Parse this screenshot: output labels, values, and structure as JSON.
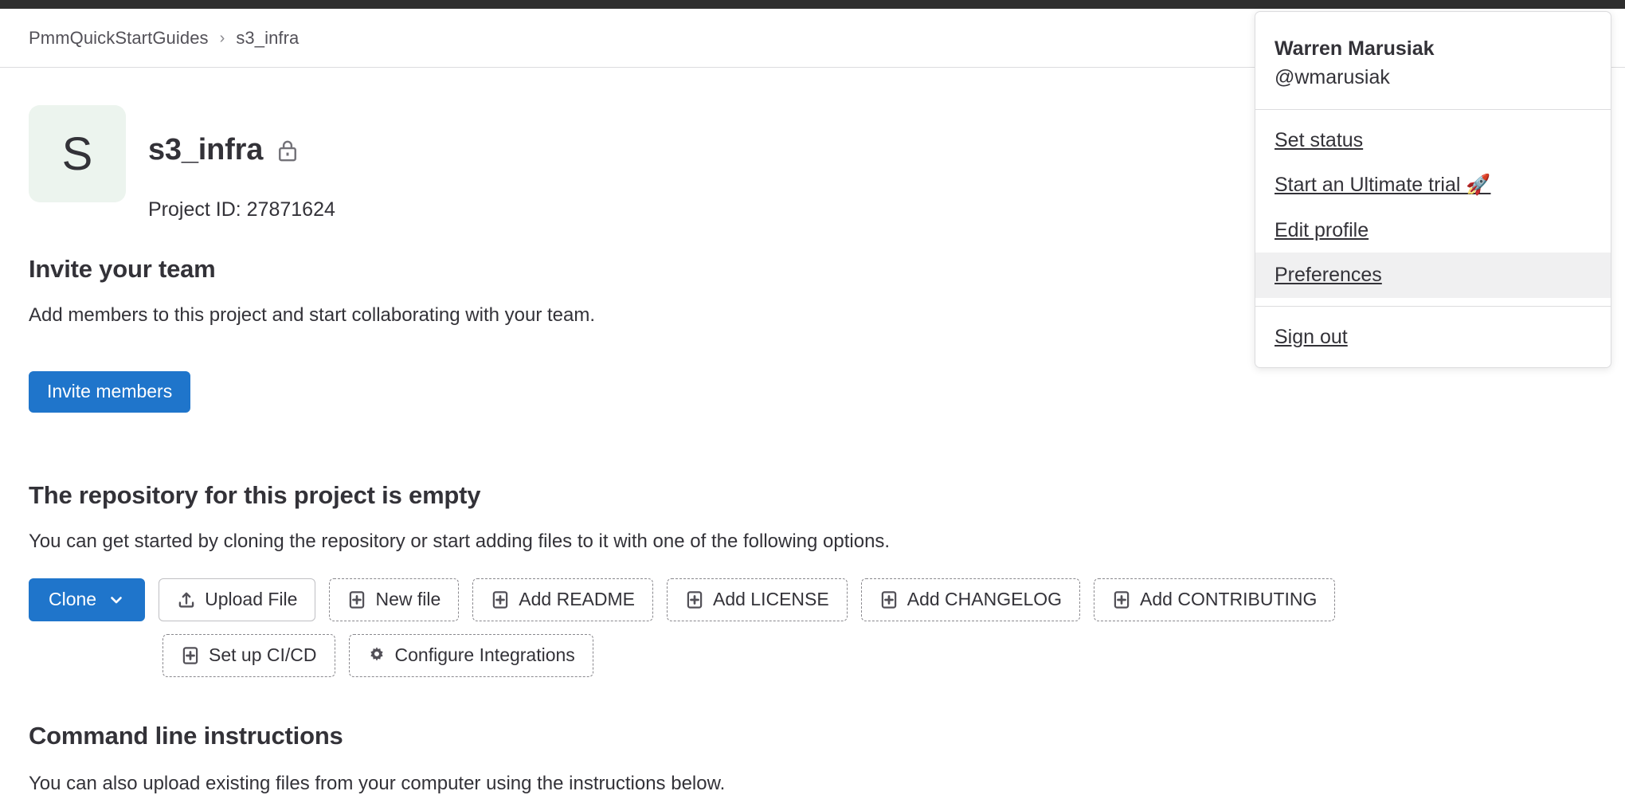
{
  "breadcrumb": {
    "items": [
      {
        "label": "PmmQuickStartGuides"
      },
      {
        "label": "s3_infra"
      }
    ],
    "separator": "›"
  },
  "project": {
    "avatar_letter": "S",
    "avatar_bg": "#ecf4ee",
    "name": "s3_infra",
    "visibility_icon": "lock-icon",
    "project_id_label": "Project ID: 27871624"
  },
  "header_actions": {
    "notifications_icon": "bell-icon"
  },
  "invite": {
    "heading": "Invite your team",
    "description": "Add members to this project and start collaborating with your team.",
    "button_label": "Invite members",
    "button_color": "#1f75cb"
  },
  "empty_repo": {
    "heading": "The repository for this project is empty",
    "description": "You can get started by cloning the repository or start adding files to it with one of the following options.",
    "rows": [
      [
        {
          "label": "Clone",
          "style": "clone",
          "icon": "chevron-down-icon",
          "icon_side": "right",
          "name": "clone-button"
        },
        {
          "label": "Upload File",
          "style": "solid",
          "icon": "upload-icon",
          "icon_side": "left",
          "name": "upload-file-button"
        },
        {
          "label": "New file",
          "style": "dashed",
          "icon": "plus-square-icon",
          "icon_side": "left",
          "name": "new-file-button"
        },
        {
          "label": "Add README",
          "style": "dashed",
          "icon": "plus-square-icon",
          "icon_side": "left",
          "name": "add-readme-button"
        },
        {
          "label": "Add LICENSE",
          "style": "dashed",
          "icon": "plus-square-icon",
          "icon_side": "left",
          "name": "add-license-button"
        },
        {
          "label": "Add CHANGELOG",
          "style": "dashed",
          "icon": "plus-square-icon",
          "icon_side": "left",
          "name": "add-changelog-button"
        },
        {
          "label": "Add CONTRIBUTING",
          "style": "dashed",
          "icon": "plus-square-icon",
          "icon_side": "left",
          "name": "add-contributing-button"
        }
      ],
      [
        {
          "label": "Set up CI/CD",
          "style": "dashed",
          "icon": "plus-square-icon",
          "icon_side": "left",
          "name": "set-up-cicd-button"
        },
        {
          "label": "Configure Integrations",
          "style": "dashed",
          "icon": "gear-icon",
          "icon_side": "left",
          "name": "configure-integrations-button"
        }
      ]
    ]
  },
  "cli": {
    "heading": "Command line instructions",
    "description": "You can also upload existing files from your computer using the instructions below."
  },
  "user_menu": {
    "name": "Warren Marusiak",
    "handle": "@wmarusiak",
    "groups": [
      {
        "items": [
          {
            "label": "Set status",
            "active": false,
            "name": "menu-item-set-status"
          },
          {
            "label": "Start an Ultimate trial 🚀",
            "active": false,
            "name": "menu-item-ultimate-trial"
          },
          {
            "label": "Edit profile",
            "active": false,
            "name": "menu-item-edit-profile"
          },
          {
            "label": "Preferences",
            "active": true,
            "name": "menu-item-preferences"
          }
        ]
      },
      {
        "items": [
          {
            "label": "Sign out",
            "active": false,
            "name": "menu-item-sign-out"
          }
        ]
      }
    ]
  }
}
